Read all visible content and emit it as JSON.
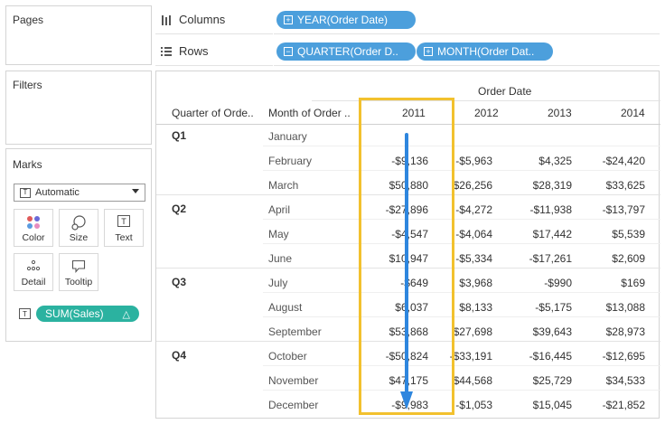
{
  "pages": {
    "title": "Pages"
  },
  "filters": {
    "title": "Filters"
  },
  "marks": {
    "title": "Marks",
    "type": "Automatic",
    "buttons": {
      "color": "Color",
      "size": "Size",
      "text": "Text",
      "detail": "Detail",
      "tooltip": "Tooltip"
    },
    "pill": "SUM(Sales)",
    "delta": "△"
  },
  "shelves": {
    "columns": {
      "label": "Columns",
      "pills": [
        "YEAR(Order Date)"
      ]
    },
    "rows": {
      "label": "Rows",
      "pills": [
        "QUARTER(Order D..",
        "MONTH(Order Dat.."
      ]
    }
  },
  "table": {
    "top_header": "Order Date",
    "col_quarter": "Quarter of Orde..",
    "col_month": "Month of Order ..",
    "years": [
      "2011",
      "2012",
      "2013",
      "2014"
    ],
    "quarters": [
      "Q1",
      "Q2",
      "Q3",
      "Q4"
    ],
    "rows": [
      {
        "month": "January",
        "values": [
          "",
          "",
          "",
          ""
        ]
      },
      {
        "month": "February",
        "values": [
          "-$9,136",
          "-$5,963",
          "$4,325",
          "-$24,420"
        ]
      },
      {
        "month": "March",
        "values": [
          "$50,880",
          "$26,256",
          "$28,319",
          "$33,625"
        ]
      },
      {
        "month": "April",
        "values": [
          "-$27,896",
          "-$4,272",
          "-$11,938",
          "-$13,797"
        ]
      },
      {
        "month": "May",
        "values": [
          "-$4,547",
          "-$4,064",
          "$17,442",
          "$5,539"
        ]
      },
      {
        "month": "June",
        "values": [
          "$10,947",
          "-$5,334",
          "-$17,261",
          "$2,609"
        ]
      },
      {
        "month": "July",
        "values": [
          "-$649",
          "$3,968",
          "-$990",
          "$169"
        ]
      },
      {
        "month": "August",
        "values": [
          "$6,037",
          "$8,133",
          "-$5,175",
          "$13,088"
        ]
      },
      {
        "month": "September",
        "values": [
          "$53,868",
          "$27,698",
          "$39,643",
          "$28,973"
        ]
      },
      {
        "month": "October",
        "values": [
          "-$50,824",
          "-$33,191",
          "-$16,445",
          "-$12,695"
        ]
      },
      {
        "month": "November",
        "values": [
          "$47,175",
          "$44,568",
          "$25,729",
          "$34,533"
        ]
      },
      {
        "month": "December",
        "values": [
          "-$9,983",
          "-$1,053",
          "$15,045",
          "-$21,852"
        ]
      }
    ]
  },
  "colors": {
    "highlight": "#f2c12e",
    "arrow": "#2e86de",
    "blue_pill": "#4c9fdc",
    "teal_pill": "#2bb2a0"
  }
}
